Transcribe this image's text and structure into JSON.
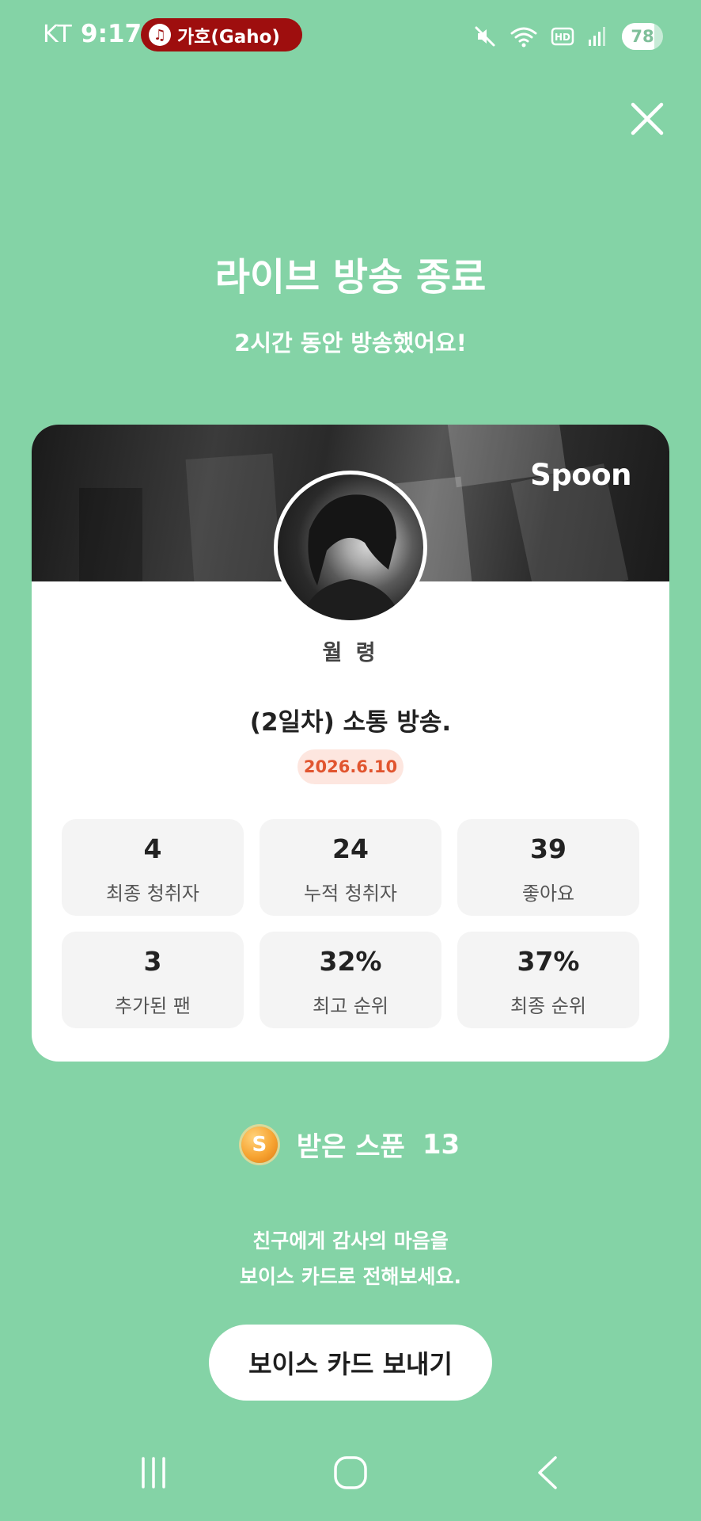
{
  "status_bar": {
    "carrier": "KT",
    "time": "9:17",
    "now_playing": "가호(Gaho)",
    "battery_level": "78",
    "battery_fraction": 0.78,
    "icons": [
      "mute-icon",
      "wifi-icon",
      "hd-voice-icon",
      "signal-icon",
      "battery-icon"
    ]
  },
  "header": {
    "title": "라이브 방송 종료",
    "subtitle": "2시간 동안 방송했어요!"
  },
  "card": {
    "brand": "Spoon",
    "streamer_name": "월 령",
    "broadcast_title": "(2일차) 소통 방송.",
    "date": "2026.6.10",
    "stats": [
      {
        "value": "4",
        "label": "최종 청취자"
      },
      {
        "value": "24",
        "label": "누적 청취자"
      },
      {
        "value": "39",
        "label": "좋아요"
      },
      {
        "value": "3",
        "label": "추가된 팬"
      },
      {
        "value": "32%",
        "label": "최고 순위"
      },
      {
        "value": "37%",
        "label": "최종 순위"
      }
    ]
  },
  "spoons": {
    "coin_letter": "S",
    "label": "받은 스푼",
    "count": "13"
  },
  "voice_card": {
    "prompt_line1": "친구에게 감사의 마음을",
    "prompt_line2": "보이스 카드로 전해보세요.",
    "button_label": "보이스 카드 보내기"
  },
  "colors": {
    "background": "#84d3a6",
    "date_badge_text": "#e1552f",
    "now_playing_chip": "#9e0e0e"
  },
  "nav": [
    "recent-apps-icon",
    "home-icon",
    "back-icon"
  ]
}
